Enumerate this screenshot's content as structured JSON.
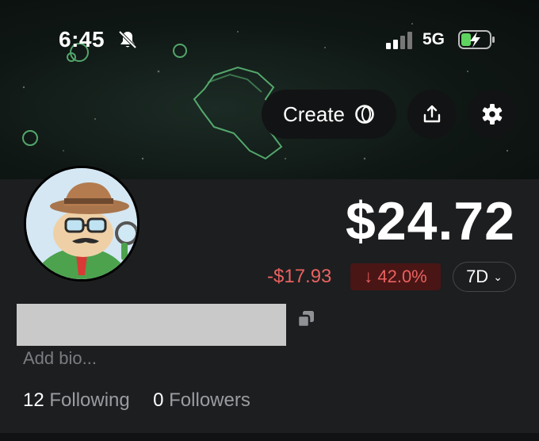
{
  "status_bar": {
    "time": "6:45",
    "network": "5G",
    "icons": [
      "bell-slash-icon",
      "signal-bars-icon",
      "battery-charging-icon"
    ]
  },
  "header": {
    "create_label": "Create",
    "icons": [
      "create-ring-icon",
      "share-icon",
      "gear-icon"
    ]
  },
  "profile": {
    "balance": "$24.72",
    "change_amount": "-$17.93",
    "change_percent": "↓ 42.0%",
    "period": "7D",
    "bio_placeholder": "Add bio...",
    "following_count": "12",
    "following_label": "Following",
    "followers_count": "0",
    "followers_label": "Followers"
  },
  "colors": {
    "background": "#1d1e20",
    "negative": "#e8625f",
    "negative_badge": "#4a1515",
    "banner_accent": "#5fbf7a"
  }
}
